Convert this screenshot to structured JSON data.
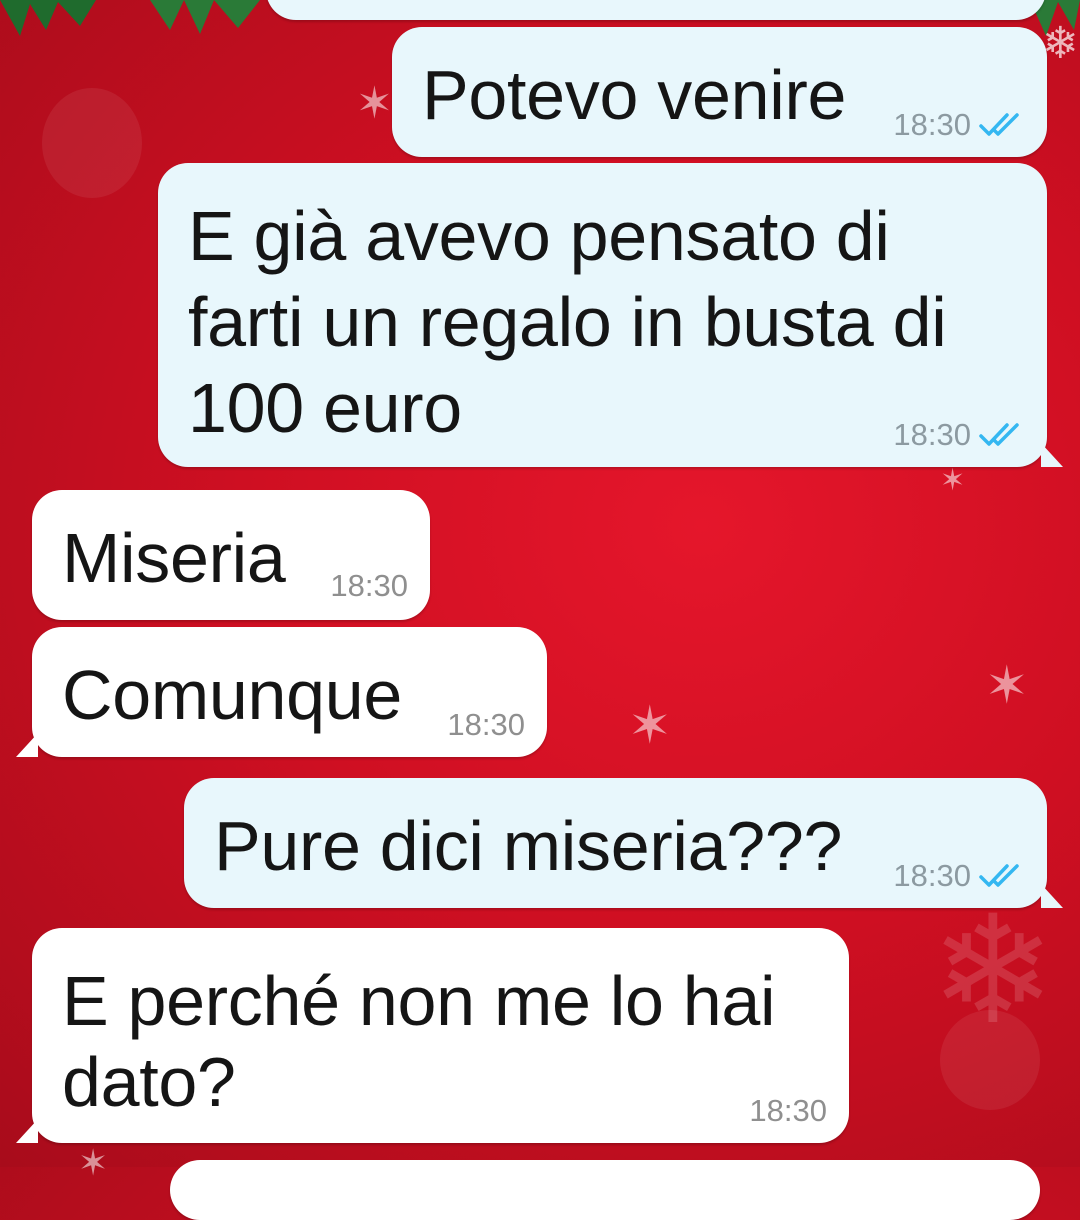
{
  "chat": {
    "messages": [
      {
        "direction": "outgoing",
        "lines": [
          ""
        ],
        "time": "",
        "status": ""
      },
      {
        "direction": "outgoing",
        "lines": [
          "Potevo venire"
        ],
        "time": "18:30",
        "status": "read"
      },
      {
        "direction": "outgoing",
        "lines": [
          "E già avevo pensato di",
          "farti un regalo in busta di",
          "100 euro"
        ],
        "time": "18:30",
        "status": "read"
      },
      {
        "direction": "incoming",
        "lines": [
          "Miseria"
        ],
        "time": "18:30"
      },
      {
        "direction": "incoming",
        "lines": [
          "Comunque"
        ],
        "time": "18:30"
      },
      {
        "direction": "outgoing",
        "lines": [
          "Pure dici miseria???"
        ],
        "time": "18:30",
        "status": "read"
      },
      {
        "direction": "incoming",
        "lines": [
          "E perché non me lo hai",
          "dato?"
        ],
        "time": "18:30"
      }
    ]
  },
  "colors": {
    "background": "#d5121f",
    "outgoing_bubble": "#e8f7fc",
    "incoming_bubble": "#ffffff",
    "read_ticks": "#34b7f1",
    "timestamp": "#8c9aa1"
  },
  "icons": {
    "read_receipt": "double-check-icon",
    "decor": [
      "star-icon",
      "snowflake-icon",
      "pine-branch-icon"
    ]
  }
}
